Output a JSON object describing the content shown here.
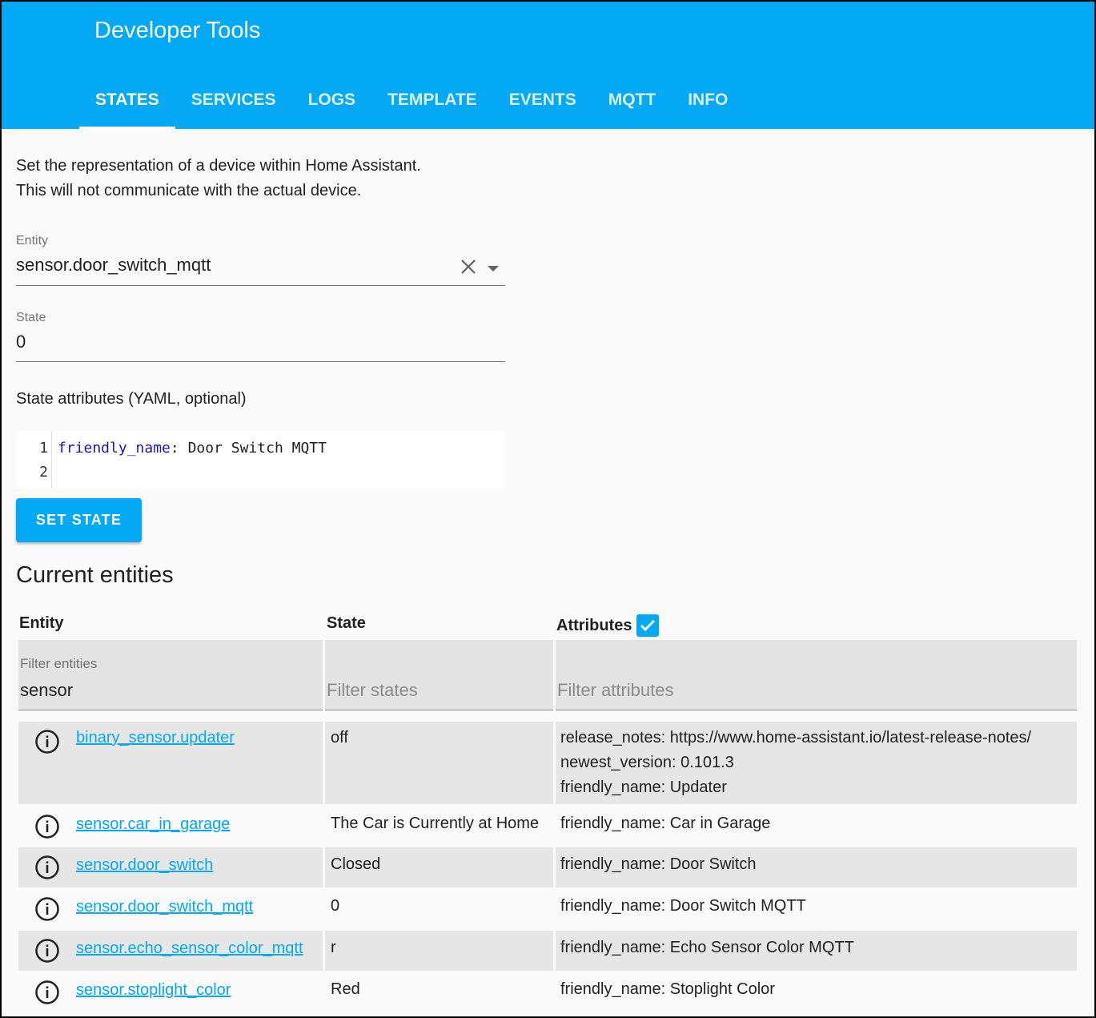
{
  "header": {
    "title": "Developer Tools",
    "tabs": [
      {
        "label": "STATES",
        "active": true
      },
      {
        "label": "SERVICES",
        "active": false
      },
      {
        "label": "LOGS",
        "active": false
      },
      {
        "label": "TEMPLATE",
        "active": false
      },
      {
        "label": "EVENTS",
        "active": false
      },
      {
        "label": "MQTT",
        "active": false
      },
      {
        "label": "INFO",
        "active": false
      }
    ]
  },
  "description": {
    "line1": "Set the representation of a device within Home Assistant.",
    "line2": "This will not communicate with the actual device."
  },
  "entity_field": {
    "label": "Entity",
    "value": "sensor.door_switch_mqtt"
  },
  "state_field": {
    "label": "State",
    "value": "0"
  },
  "attributes_editor": {
    "label": "State attributes (YAML, optional)",
    "line_numbers": [
      "1",
      "2"
    ],
    "key": "friendly_name",
    "colon": ":",
    "value": " Door Switch MQTT"
  },
  "set_state_label": "SET STATE",
  "current_entities": {
    "title": "Current entities",
    "col_entity": "Entity",
    "col_state": "State",
    "col_attributes": "Attributes",
    "attributes_checked": true,
    "filter_entities_label": "Filter entities",
    "filter_entities_value": "sensor",
    "filter_states_placeholder": "Filter states",
    "filter_attributes_placeholder": "Filter attributes",
    "rows": [
      {
        "entity": "binary_sensor.updater",
        "state": "off",
        "attributes": [
          "release_notes: https://www.home-assistant.io/latest-release-notes/",
          "newest_version: 0.101.3",
          "friendly_name: Updater"
        ]
      },
      {
        "entity": "sensor.car_in_garage",
        "state": "The Car is Currently at Home",
        "attributes": [
          "friendly_name: Car in Garage"
        ]
      },
      {
        "entity": "sensor.door_switch",
        "state": "Closed",
        "attributes": [
          "friendly_name: Door Switch"
        ]
      },
      {
        "entity": "sensor.door_switch_mqtt",
        "state": "0",
        "attributes": [
          "friendly_name: Door Switch MQTT"
        ]
      },
      {
        "entity": "sensor.echo_sensor_color_mqtt",
        "state": "r",
        "attributes": [
          "friendly_name: Echo Sensor Color MQTT"
        ]
      },
      {
        "entity": "sensor.stoplight_color",
        "state": "Red",
        "attributes": [
          "friendly_name: Stoplight Color"
        ]
      }
    ]
  },
  "colors": {
    "accent": "#03a9f4",
    "row_shade": "#e6e6e6"
  },
  "icons": {
    "clear": "close-icon",
    "dropdown": "caret-down-icon",
    "info": "info-circle-icon",
    "check": "checkmark-icon"
  }
}
